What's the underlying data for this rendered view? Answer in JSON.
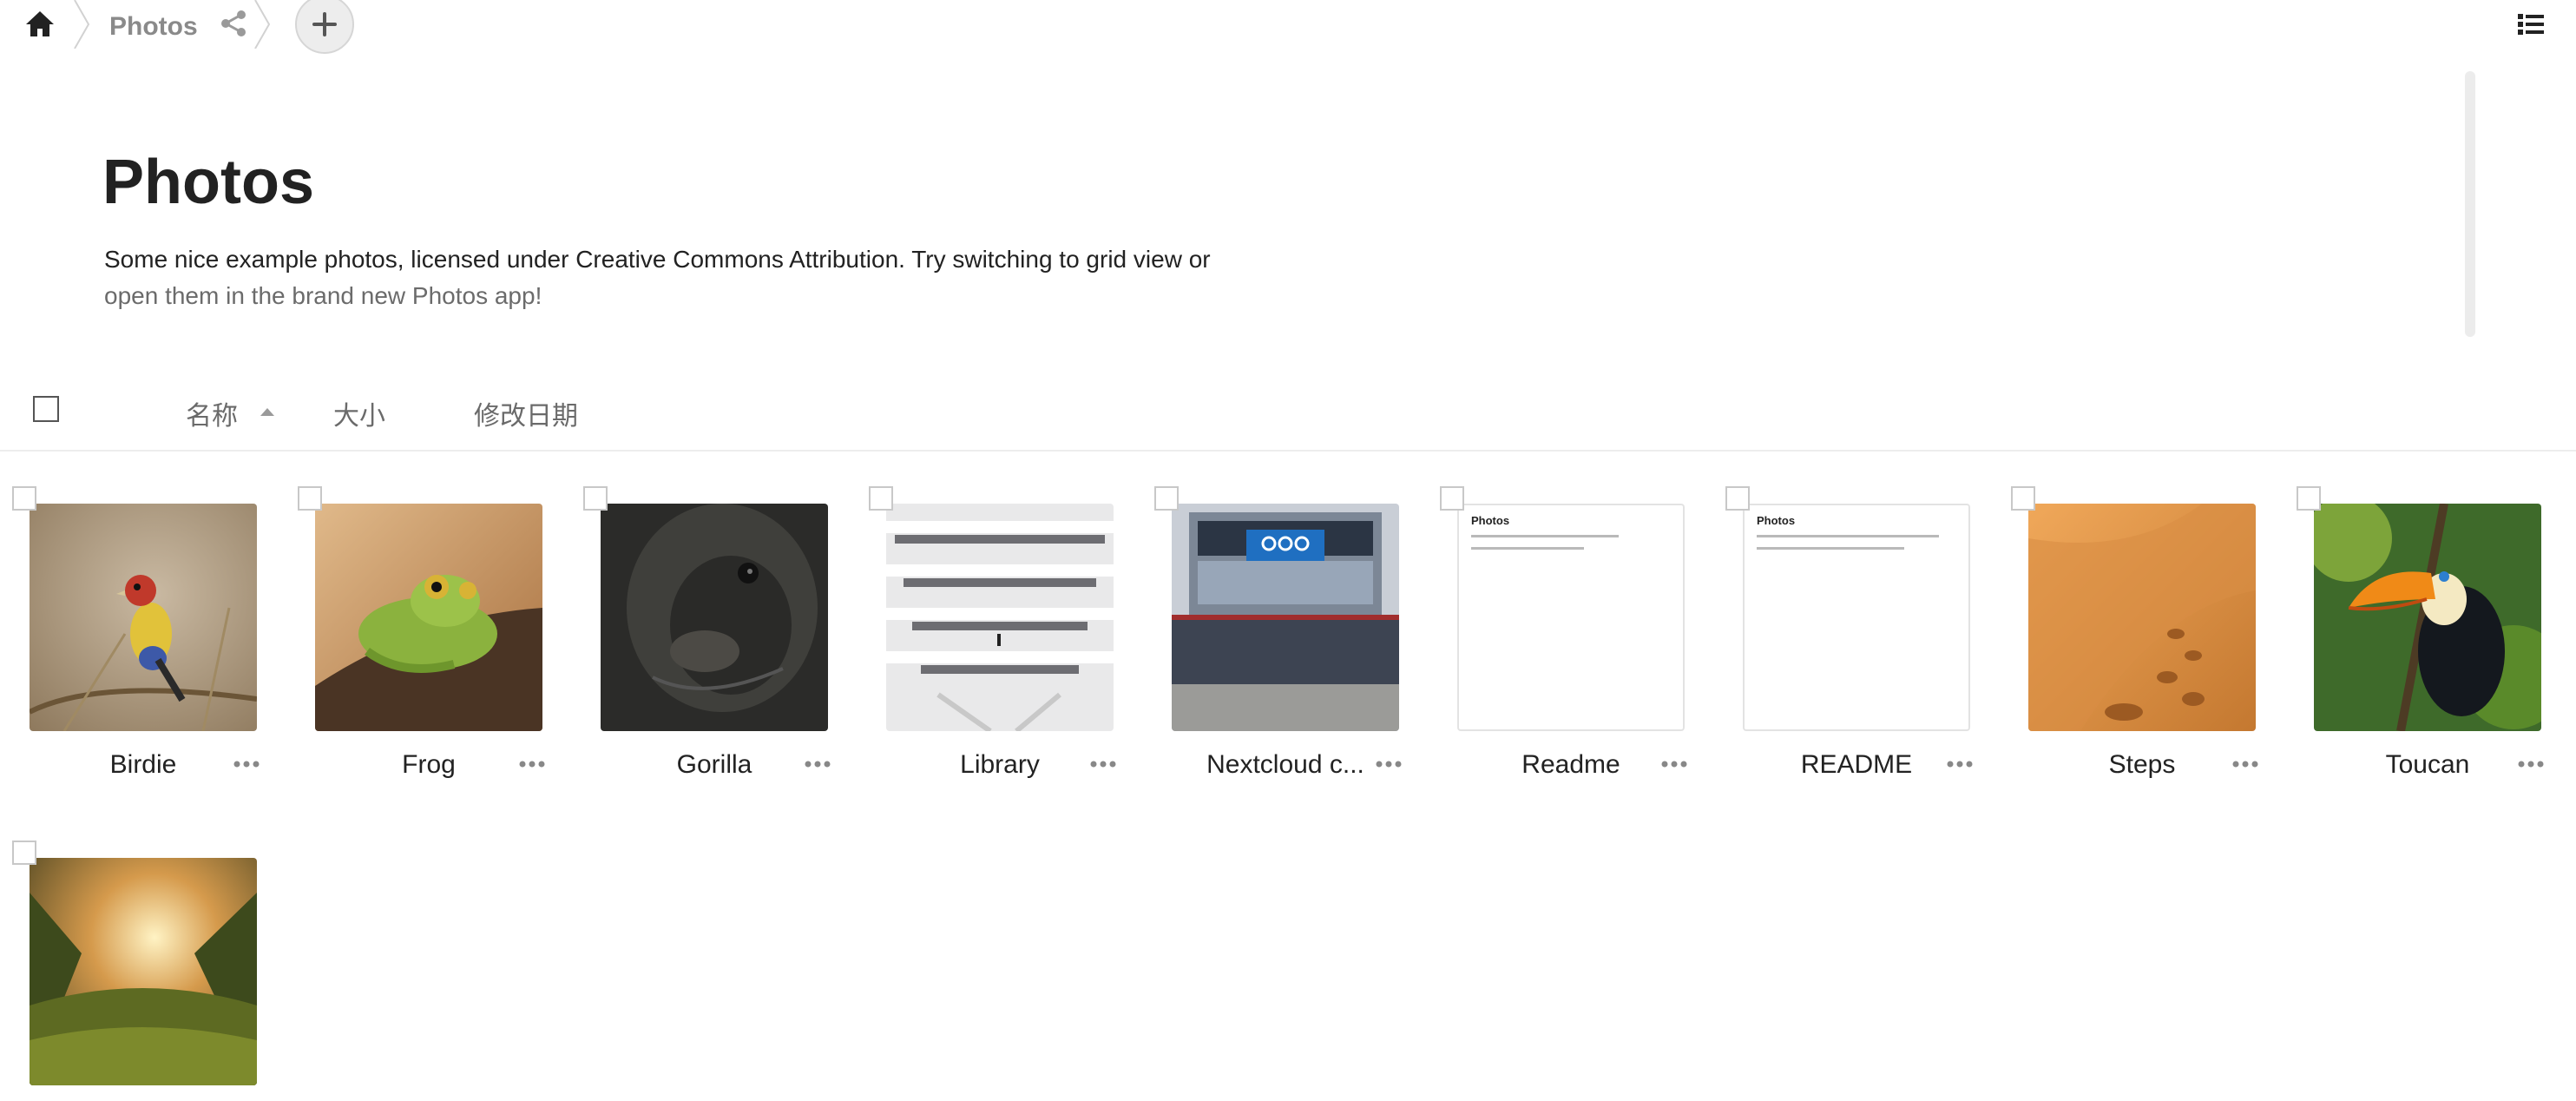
{
  "breadcrumb": {
    "title": "Photos"
  },
  "icons": {
    "home": "home-icon",
    "share": "share-icon",
    "add": "plus-icon",
    "view_toggle": "list-view-icon",
    "more": "more-horizontal-icon"
  },
  "description": {
    "title": "Photos",
    "text_line1": "Some nice example photos, licensed under Creative Commons Attribution. Try switching to grid view or",
    "text_line2": "open them in the brand new Photos app!"
  },
  "list_header": {
    "name": "名称",
    "size": "大小",
    "modified": "修改日期",
    "sort": "name-ascending"
  },
  "files": [
    {
      "name": "Birdie"
    },
    {
      "name": "Frog"
    },
    {
      "name": "Gorilla"
    },
    {
      "name": "Library"
    },
    {
      "name": "Nextcloud c..."
    },
    {
      "name": "Readme"
    },
    {
      "name": "README"
    },
    {
      "name": "Steps"
    },
    {
      "name": "Toucan"
    },
    {
      "name": ""
    }
  ],
  "readme_preview": {
    "title": "Photos"
  },
  "colors": {
    "text": "#222222",
    "muted": "#6a6a6a",
    "button_bg": "#ededed",
    "border": "#ededed"
  }
}
